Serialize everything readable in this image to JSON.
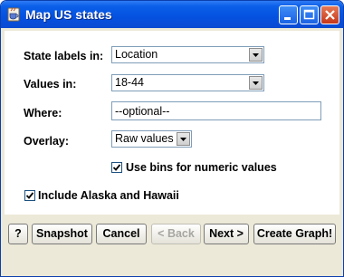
{
  "window": {
    "title": "Map US states"
  },
  "form": {
    "state_labels_label": "State labels in:",
    "state_labels_value": "Location",
    "values_label": "Values in:",
    "values_value": "18-44",
    "where_label": "Where:",
    "where_placeholder": "--optional--",
    "overlay_label": "Overlay:",
    "overlay_value": "Raw values",
    "use_bins_label": "Use bins for numeric values",
    "use_bins_checked": true,
    "include_ak_hi_label": "Include Alaska and Hawaii",
    "include_ak_hi_checked": true
  },
  "buttons": {
    "help": "?",
    "snapshot": "Snapshot",
    "cancel": "Cancel",
    "back": "< Back",
    "next": "Next >",
    "create_graph": "Create Graph!"
  },
  "colors": {
    "titlebar": "#0551e0",
    "dialog_bg": "#ece9d8",
    "field_border": "#7f9db9"
  }
}
